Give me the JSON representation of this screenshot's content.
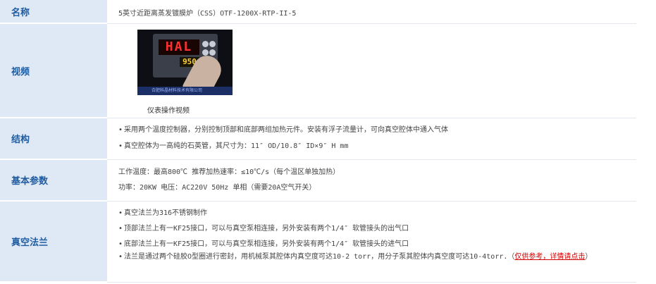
{
  "rows": {
    "name": {
      "label": "名称",
      "value": "5英寸近距离蒸发镀膜炉（CSS）OTF-1200X-RTP-II-5"
    },
    "video": {
      "label": "视频",
      "thumb_display_main": "HAL",
      "thumb_display_sub": "950",
      "thumb_caption": "合肥科晶材料技术有限公司",
      "caption": "仪表操作视频"
    },
    "structure": {
      "label": "结构",
      "lines": [
        "采用两个温度控制器，分别控制顶部和底部两组加热元件。安装有浮子流量计，可向真空腔体中通入气体",
        "真空腔体为一高纯的石英管，其尺寸为：11″ OD/10.8″ ID×9″ H  mm"
      ]
    },
    "params": {
      "label": "基本参数",
      "lines": [
        "工作温度：最高800℃    推荐加热速率：≤10℃/s（每个温区单独加热）",
        "功率：20KW    电压：AC220V 50Hz 单相（需要20A空气开关）"
      ]
    },
    "flange": {
      "label": "真空法兰",
      "lines": [
        "真空法兰为316不锈钢制作",
        "顶部法兰上有一KF25接口，可以与真空泵相连接，另外安装有两个1/4″ 软管接头的出气口",
        "底部法兰上有一KF25接口，可以与真空泵相连接，另外安装有两个1/4″ 软管接头的进气口"
      ],
      "last_line_text": "法兰是通过两个硅胶O型圈进行密封，用机械泵其腔体内真空度可达10-2 torr，用分子泵其腔体内真空度可达10-4torr.（",
      "last_line_link": "仅供参考，详情请点击",
      "last_line_end": "）"
    }
  },
  "bullet": "•",
  "colors": {
    "label_bg": "#dfe9f6",
    "label_text": "#1f5ca0",
    "link_red": "#d00000"
  }
}
